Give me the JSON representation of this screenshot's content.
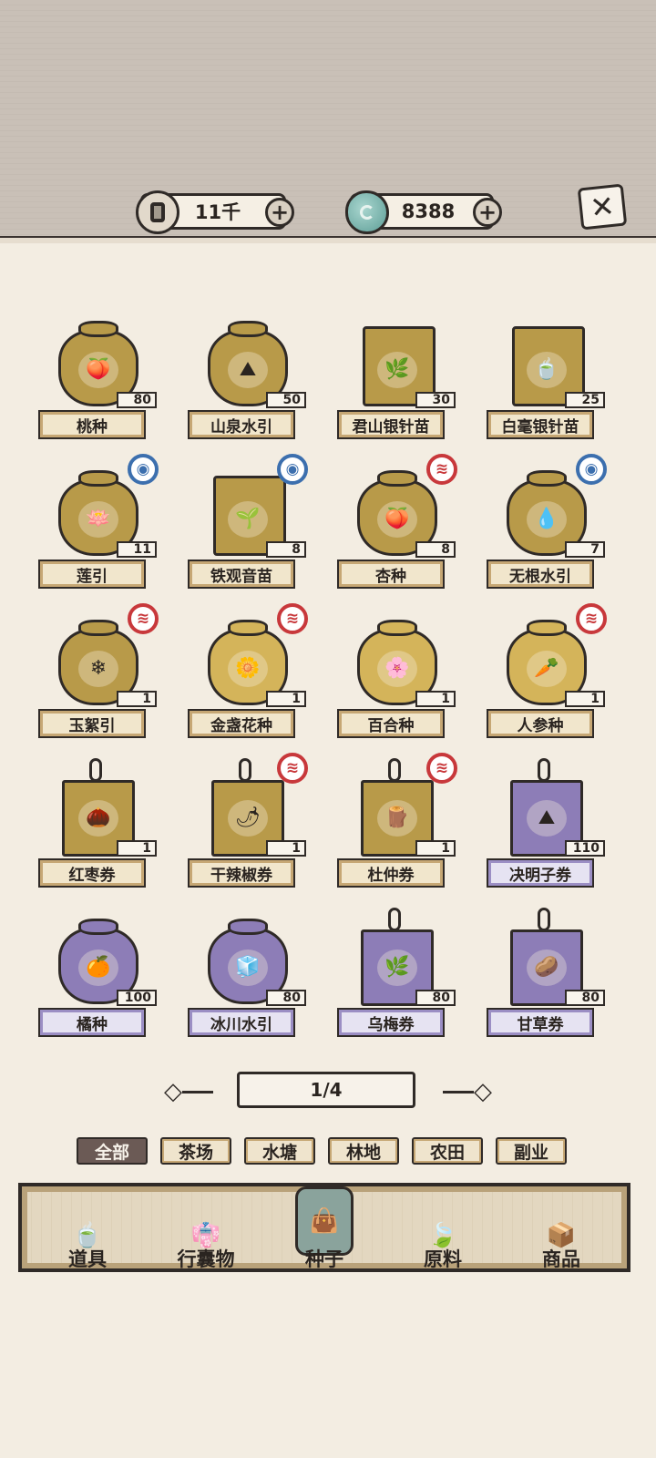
{
  "currencies": [
    {
      "name": "coin",
      "value": "11千",
      "icon": "coin-icon"
    },
    {
      "name": "jade",
      "value": "8388",
      "icon": "jade-icon"
    }
  ],
  "plus_glyph": "+",
  "close_glyph": "✕",
  "items": [
    {
      "name": "桃种",
      "count": "80",
      "style": "bag",
      "color": "#b89a49",
      "glyph": "🍑",
      "badge": null,
      "label_style": "gold"
    },
    {
      "name": "山泉水引",
      "count": "50",
      "style": "bag",
      "color": "#b89a49",
      "glyph": "⛰",
      "badge": null,
      "label_style": "gold"
    },
    {
      "name": "君山银针苗",
      "count": "30",
      "style": "rect",
      "color": "#b89a49",
      "glyph": "🌿",
      "badge": null,
      "label_style": "gold"
    },
    {
      "name": "白毫银针苗",
      "count": "25",
      "style": "rect",
      "color": "#b89a49",
      "glyph": "🍵",
      "badge": null,
      "label_style": "gold"
    },
    {
      "name": "莲引",
      "count": "11",
      "style": "bag",
      "color": "#b89a49",
      "glyph": "🪷",
      "badge": "blue",
      "label_style": "gold"
    },
    {
      "name": "铁观音苗",
      "count": "8",
      "style": "rect",
      "color": "#b89a49",
      "glyph": "🌱",
      "badge": "blue",
      "label_style": "gold"
    },
    {
      "name": "杏种",
      "count": "8",
      "style": "bag",
      "color": "#b89a49",
      "glyph": "🍑",
      "badge": "red",
      "label_style": "gold"
    },
    {
      "name": "无根水引",
      "count": "7",
      "style": "bag",
      "color": "#b89a49",
      "glyph": "💧",
      "badge": "blue",
      "label_style": "gold"
    },
    {
      "name": "玉絮引",
      "count": "1",
      "style": "bag",
      "color": "#b89a49",
      "glyph": "❄",
      "badge": "red",
      "label_style": "gold"
    },
    {
      "name": "金盏花种",
      "count": "1",
      "style": "bag",
      "color": "#d4b45a",
      "glyph": "🌼",
      "badge": "red",
      "label_style": "gold"
    },
    {
      "name": "百合种",
      "count": "1",
      "style": "bag",
      "color": "#d4b45a",
      "glyph": "🌸",
      "badge": null,
      "label_style": "gold"
    },
    {
      "name": "人参种",
      "count": "1",
      "style": "bag",
      "color": "#d4b45a",
      "glyph": "🥕",
      "badge": "red",
      "label_style": "gold"
    },
    {
      "name": "红枣券",
      "count": "1",
      "style": "ticket",
      "color": "#b89a49",
      "glyph": "🌰",
      "badge": null,
      "label_style": "gold"
    },
    {
      "name": "干辣椒券",
      "count": "1",
      "style": "ticket",
      "color": "#b89a49",
      "glyph": "🌶",
      "badge": "red",
      "label_style": "gold"
    },
    {
      "name": "杜仲券",
      "count": "1",
      "style": "ticket",
      "color": "#b89a49",
      "glyph": "🪵",
      "badge": "red",
      "label_style": "gold"
    },
    {
      "name": "决明子券",
      "count": "110",
      "style": "ticket",
      "color": "#8d7db7",
      "glyph": "⛰",
      "badge": null,
      "label_style": "purple"
    },
    {
      "name": "橘种",
      "count": "100",
      "style": "bag",
      "color": "#8d7db7",
      "glyph": "🍊",
      "badge": null,
      "label_style": "purple"
    },
    {
      "name": "冰川水引",
      "count": "80",
      "style": "bag",
      "color": "#8d7db7",
      "glyph": "🧊",
      "badge": null,
      "label_style": "purple"
    },
    {
      "name": "乌梅券",
      "count": "80",
      "style": "ticket",
      "color": "#8d7db7",
      "glyph": "🌿",
      "badge": null,
      "label_style": "purple"
    },
    {
      "name": "甘草券",
      "count": "80",
      "style": "ticket",
      "color": "#8d7db7",
      "glyph": "🥔",
      "badge": null,
      "label_style": "purple"
    }
  ],
  "pagination": {
    "text": "1/4"
  },
  "filters": [
    {
      "label": "全部",
      "active": true
    },
    {
      "label": "茶场",
      "active": false
    },
    {
      "label": "水塘",
      "active": false
    },
    {
      "label": "林地",
      "active": false
    },
    {
      "label": "农田",
      "active": false
    },
    {
      "label": "副业",
      "active": false
    }
  ],
  "tabs": [
    {
      "label": "道具",
      "icon": "tea-bowl-icon",
      "glyph": "🍵",
      "active": false
    },
    {
      "label": "行囊物",
      "icon": "clothing-icon",
      "glyph": "👘",
      "active": false
    },
    {
      "label": "种子",
      "icon": "seed-bag-icon",
      "glyph": "👜",
      "active": true
    },
    {
      "label": "原料",
      "icon": "leaf-icon",
      "glyph": "🍃",
      "active": false
    },
    {
      "label": "商品",
      "icon": "goods-icon",
      "glyph": "📦",
      "active": false
    }
  ]
}
